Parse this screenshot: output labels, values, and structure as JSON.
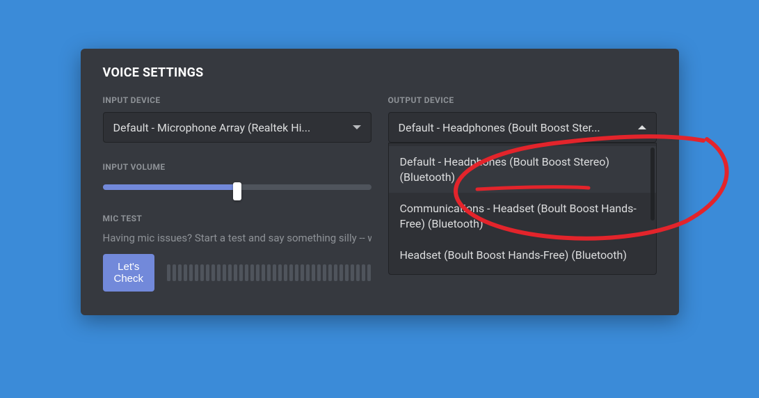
{
  "title": "VOICE SETTINGS",
  "input_device": {
    "label": "INPUT DEVICE",
    "selected": "Default - Microphone Array (Realtek Hi..."
  },
  "output_device": {
    "label": "OUTPUT DEVICE",
    "selected": "Default - Headphones (Boult Boost Ster...",
    "options": [
      "Default - Headphones (Boult Boost Stereo) (Bluetooth)",
      "Communications - Headset (Boult Boost Hands-Free) (Bluetooth)",
      "Headset (Boult Boost Hands-Free) (Bluetooth)"
    ]
  },
  "input_volume": {
    "label": "INPUT VOLUME",
    "percent": 50
  },
  "mic_test": {
    "label": "MIC TEST",
    "desc": "Having mic issues? Start a test and say something silly -- w",
    "button": "Let's Check"
  },
  "colors": {
    "accent": "#7289da",
    "annotation": "#e3242b"
  }
}
